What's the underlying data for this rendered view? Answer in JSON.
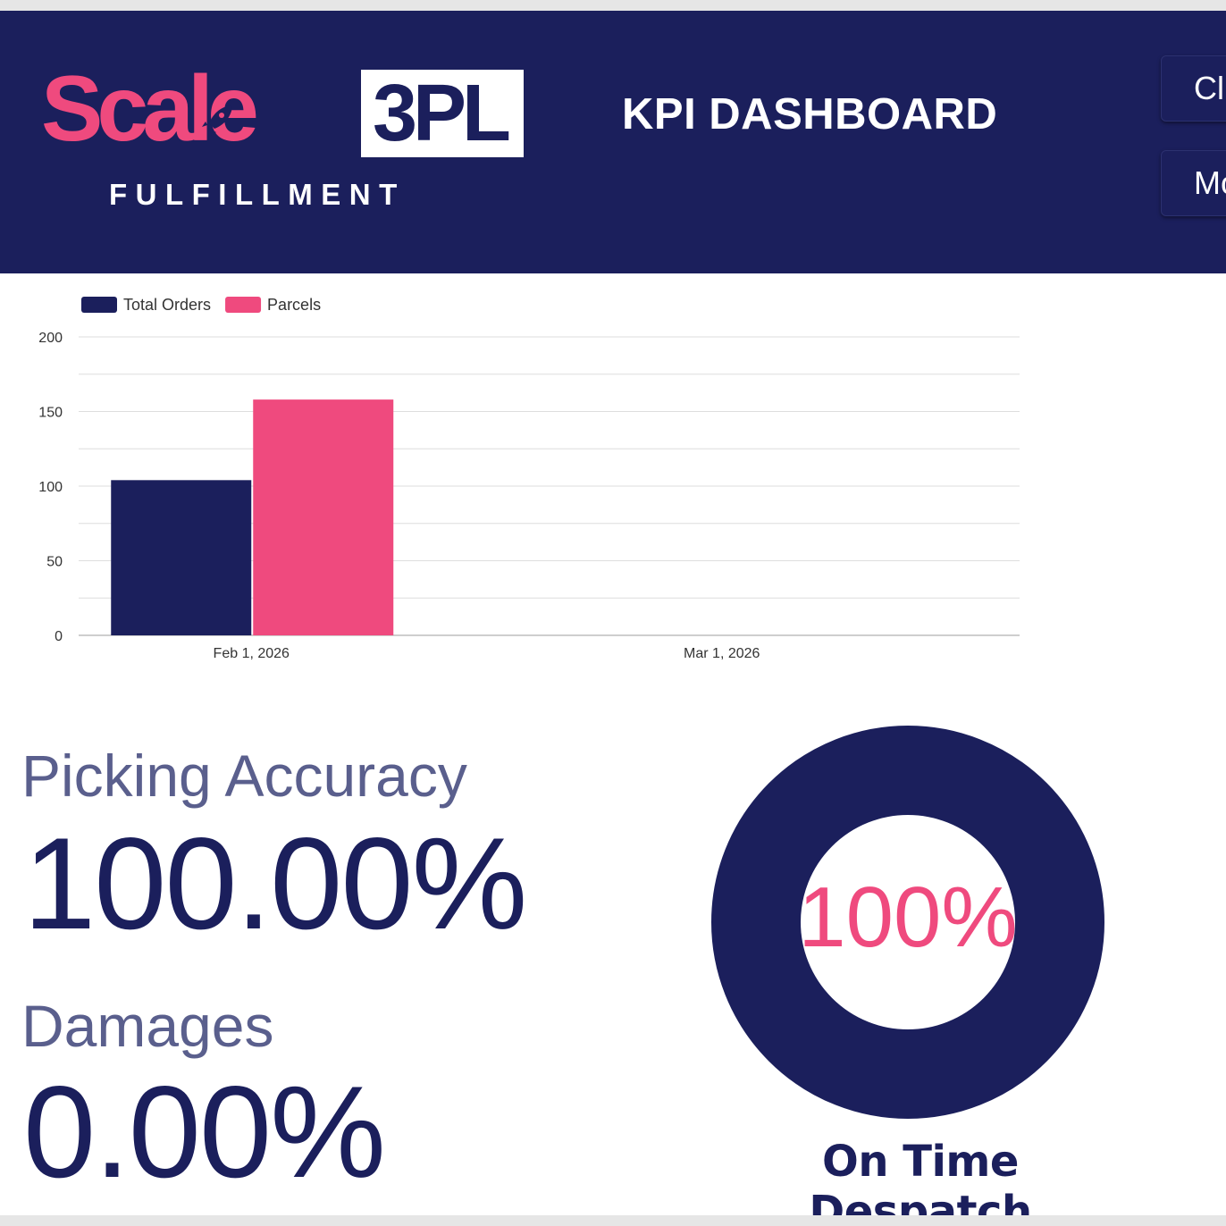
{
  "header": {
    "logo": {
      "word_primary": "Scale",
      "word_badge": "3PL",
      "tagline": "FULFILLMENT"
    },
    "title": "KPI DASHBOARD",
    "buttons": [
      {
        "label": "Cl"
      },
      {
        "label": "Mo"
      }
    ]
  },
  "colors": {
    "navy": "#1b1f5c",
    "pink": "#ef4a7e",
    "muted_label": "#5a5f8d",
    "grid": "#e0e0e0"
  },
  "chart_data": {
    "type": "bar",
    "categories": [
      "Feb 1, 2026",
      "Mar 1, 2026"
    ],
    "series": [
      {
        "name": "Total Orders",
        "color": "#1b1f5c",
        "values": [
          104,
          0
        ]
      },
      {
        "name": "Parcels",
        "color": "#ef4a7e",
        "values": [
          158,
          0
        ]
      }
    ],
    "ylim": [
      0,
      200
    ],
    "yticks": [
      0,
      50,
      100,
      150,
      200
    ],
    "grid": true,
    "legend": "top-left"
  },
  "kpis": {
    "picking_accuracy": {
      "label": "Picking Accuracy",
      "value": "100.00%"
    },
    "damages": {
      "label": "Damages",
      "value": "0.00%"
    }
  },
  "on_time": {
    "value": "100%",
    "fraction": 1.0,
    "caption": "On Time Despatch"
  }
}
